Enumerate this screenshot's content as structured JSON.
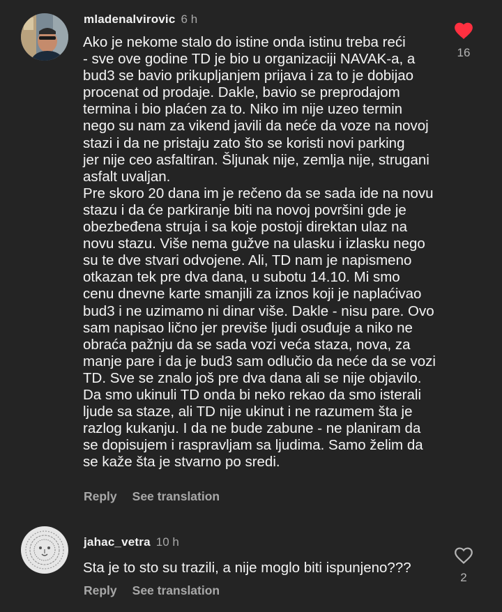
{
  "comments": [
    {
      "username": "mladenalvirovic",
      "time": "6 h",
      "lines": [
        "Ako je nekome stalo do istine onda istinu treba reći",
        "- sve ove godine TD je bio u organizaciji NAVAK-a, a",
        "bud3 se bavio prikupljanjem prijava i za to je dobijao",
        "procenat od prodaje. Dakle, bavio se preprodajom",
        "termina i bio plaćen za to. Niko im nije uzeo termin",
        "nego su nam za vikend javili da neće da voze na novoj",
        "stazi i da ne pristaju zato što se koristi novi parking",
        "jer nije ceo asfaltiran. Šljunak nije, zemlja nije, strugani",
        "asfalt uvaljan.",
        "Pre skoro 20 dana im je rečeno da se sada ide na novu",
        "stazu i da će parkiranje biti na novoj površini gde je",
        "obezbeđena struja i sa koje postoji direktan ulaz na",
        "novu stazu. Više nema gužve na ulasku i izlasku nego",
        "su te dve stvari odvojene. Ali, TD nam je napismeno",
        "otkazan tek pre dva dana, u subotu 14.10. Mi smo",
        "cenu dnevne karte smanjili za iznos koji je naplaćivao",
        "bud3 i ne uzimamo ni dinar više. Dakle - nisu pare. Ovo",
        "sam napisao lično jer previše ljudi osuđuje a niko ne",
        "obraća pažnju da se sada vozi veća staza, nova, za",
        "manje pare i da je bud3 sam odlučio da neće da se vozi",
        "TD. Sve se znalo još pre dva dana ali se nije objavilo.",
        "Da smo ukinuli TD onda bi neko rekao da smo isterali",
        "ljude sa staze, ali TD nije ukinut i ne razumem šta je",
        "razlog kukanju. I da ne bude zabune - ne planiram da",
        "se dopisujem i raspravljam sa ljudima. Samo želim da",
        "se kaže šta je stvarno po sredi."
      ],
      "reply_label": "Reply",
      "translate_label": "See translation",
      "likes": "16",
      "liked": true,
      "heart_color": "#ff3040",
      "avatar_icon": "profile-photo"
    },
    {
      "username": "jahac_vetra",
      "time": "10 h",
      "lines": [
        "Sta je to sto su trazili, a nije moglo biti ispunjeno???"
      ],
      "reply_label": "Reply",
      "translate_label": "See translation",
      "likes": "2",
      "liked": false,
      "avatar_icon": "lion-sketch-avatar"
    }
  ]
}
